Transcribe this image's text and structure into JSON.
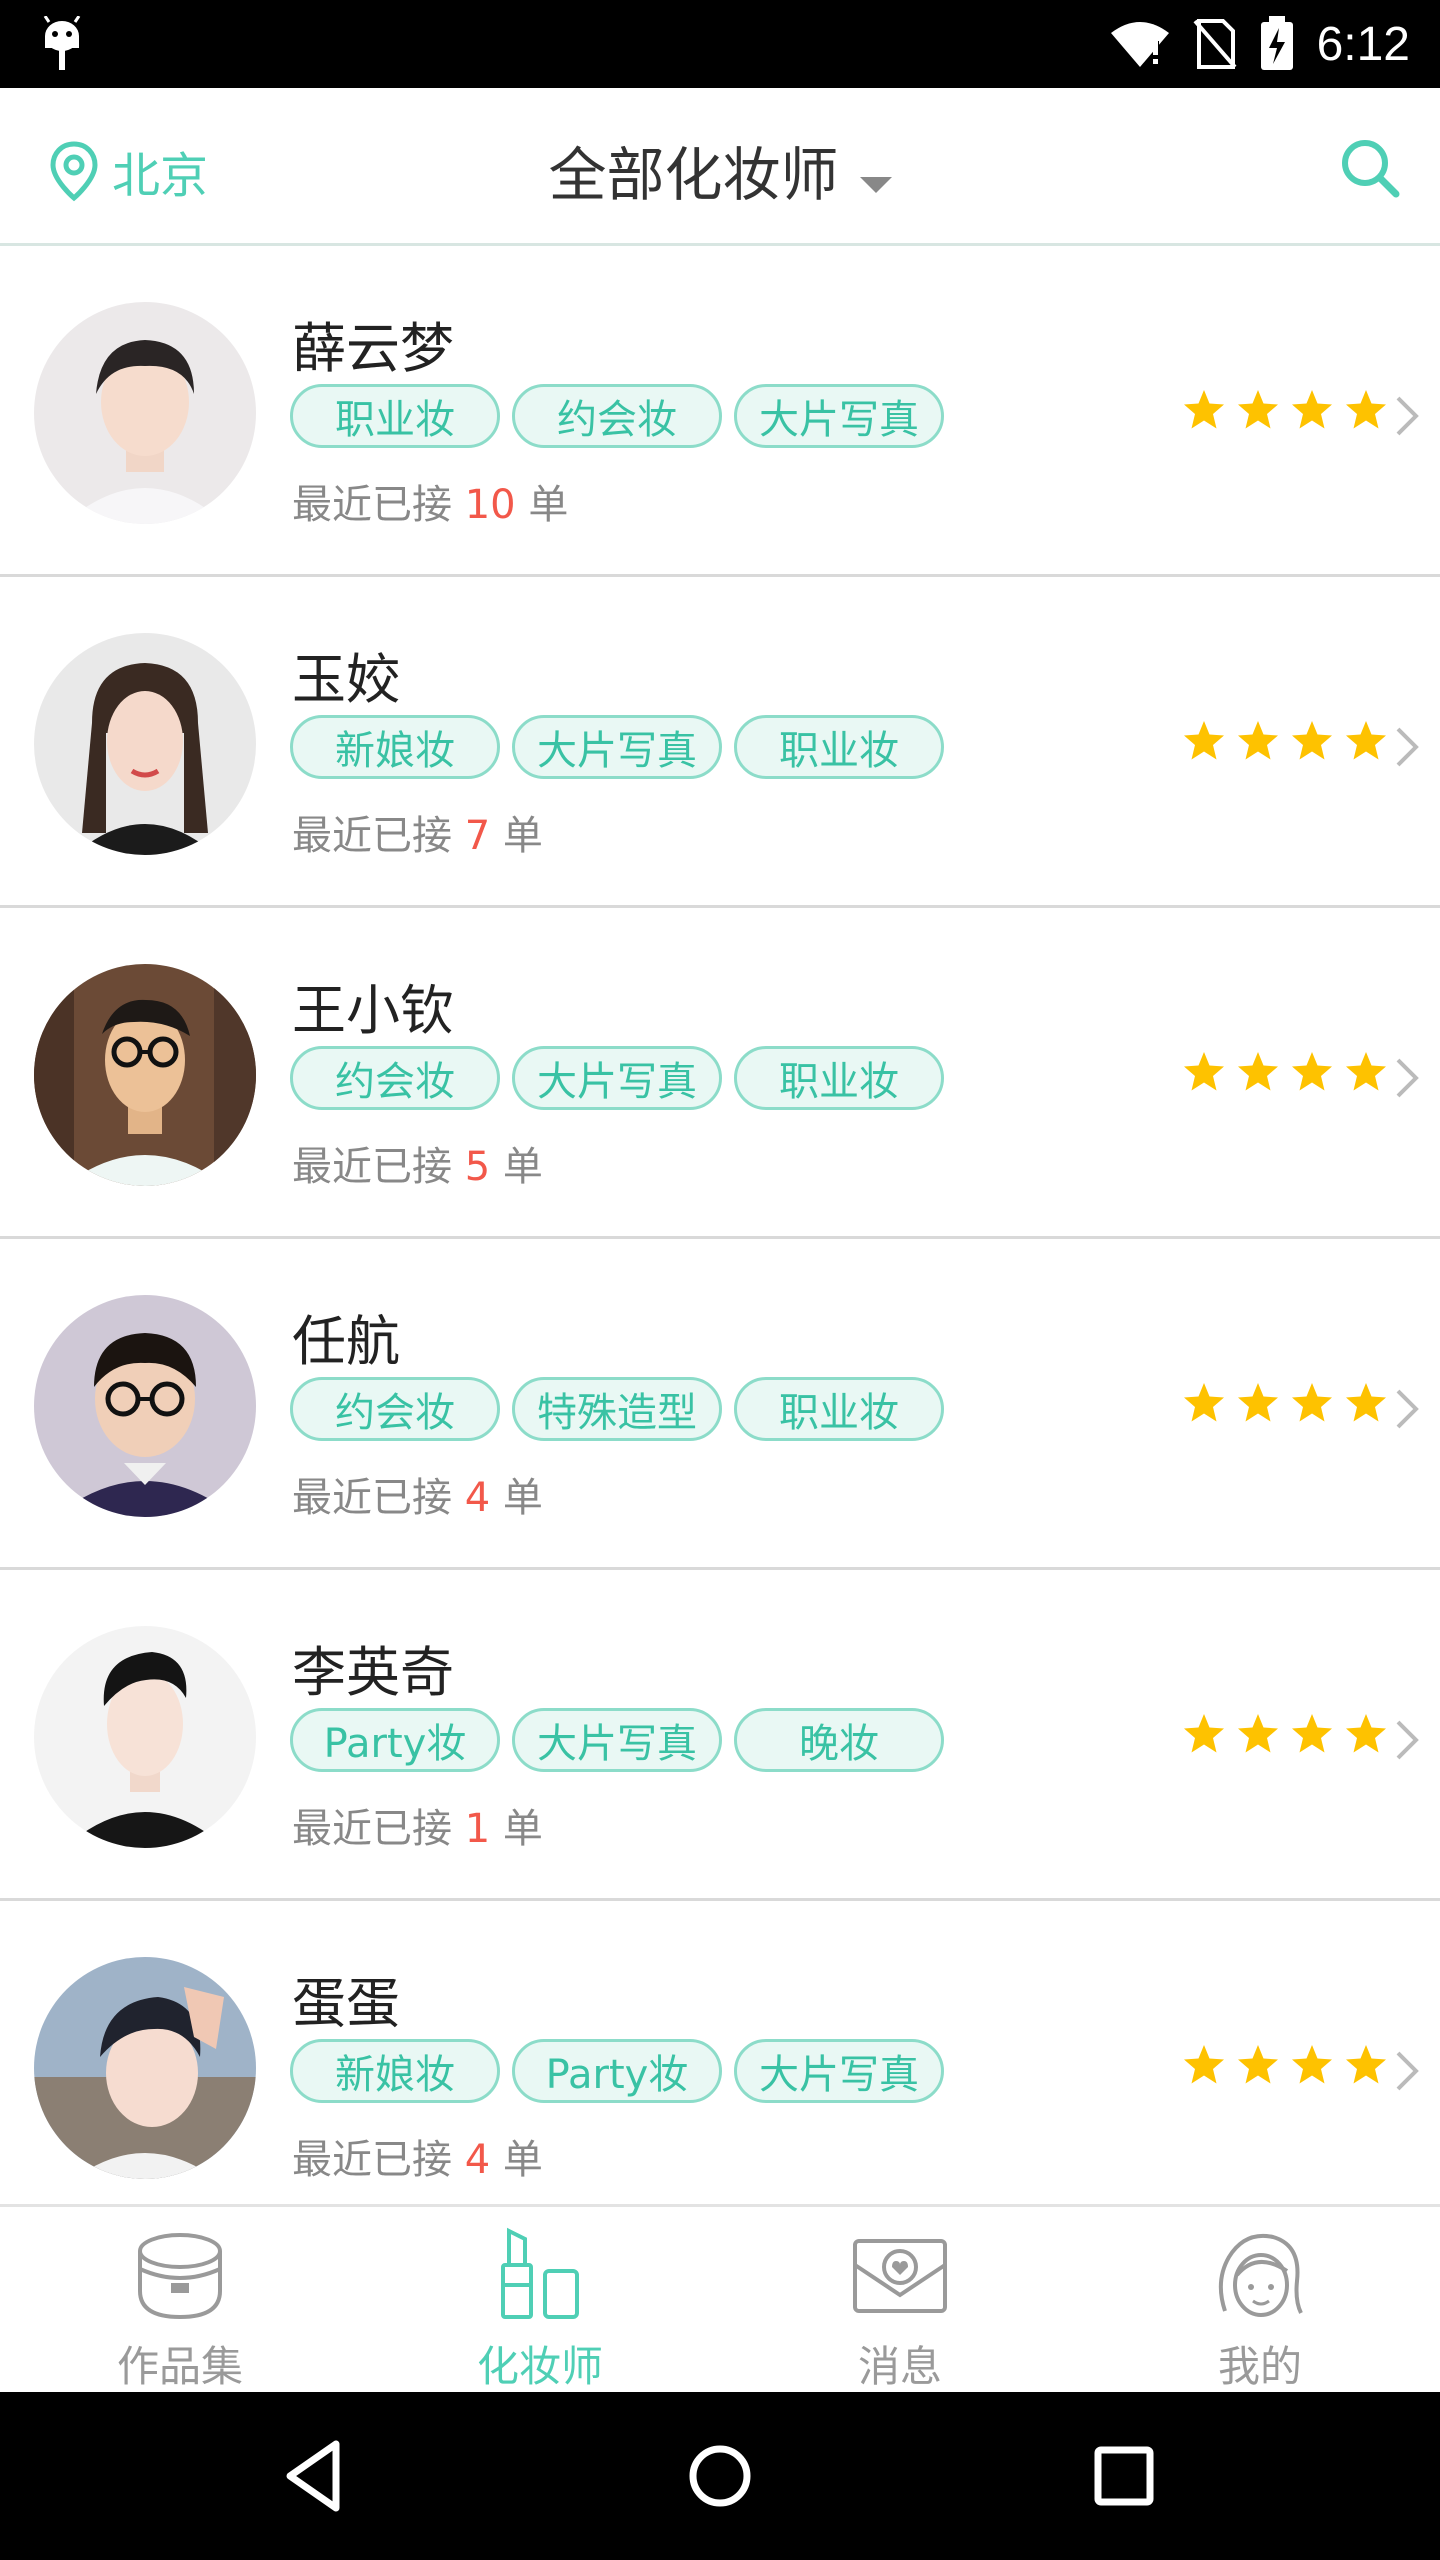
{
  "status_bar": {
    "time": "6:12"
  },
  "header": {
    "location": "北京",
    "title": "全部化妆师",
    "icons": {
      "location": "location-pin-icon",
      "search": "search-icon",
      "dropdown": "caret-down-icon"
    }
  },
  "colors": {
    "accent": "#4fcfb5",
    "star": "#fec200",
    "count": "#f2584a",
    "tag_border": "#8cdcc9"
  },
  "artists": [
    {
      "name": "薛云梦",
      "tags": [
        "职业妆",
        "约会妆",
        "大片写真"
      ],
      "recent_prefix": "最近已接",
      "count": "10",
      "recent_suffix": "单",
      "rating": 4
    },
    {
      "name": "玉姣",
      "tags": [
        "新娘妆",
        "大片写真",
        "职业妆"
      ],
      "recent_prefix": "最近已接",
      "count": "7",
      "recent_suffix": "单",
      "rating": 4
    },
    {
      "name": "王小钦",
      "tags": [
        "约会妆",
        "大片写真",
        "职业妆"
      ],
      "recent_prefix": "最近已接",
      "count": "5",
      "recent_suffix": "单",
      "rating": 4
    },
    {
      "name": "任航",
      "tags": [
        "约会妆",
        "特殊造型",
        "职业妆"
      ],
      "recent_prefix": "最近已接",
      "count": "4",
      "recent_suffix": "单",
      "rating": 4
    },
    {
      "name": "李英奇",
      "tags": [
        "Party妆",
        "大片写真",
        "晚妆"
      ],
      "recent_prefix": "最近已接",
      "count": "1",
      "recent_suffix": "单",
      "rating": 4
    },
    {
      "name": "蛋蛋",
      "tags": [
        "新娘妆",
        "Party妆",
        "大片写真"
      ],
      "recent_prefix": "最近已接",
      "count": "4",
      "recent_suffix": "单",
      "rating": 4
    }
  ],
  "tabs": [
    {
      "label": "作品集",
      "icon": "compact-case-icon",
      "active": false
    },
    {
      "label": "化妆师",
      "icon": "lipstick-icon",
      "active": true
    },
    {
      "label": "消息",
      "icon": "envelope-heart-icon",
      "active": false
    },
    {
      "label": "我的",
      "icon": "girl-face-icon",
      "active": false
    }
  ]
}
